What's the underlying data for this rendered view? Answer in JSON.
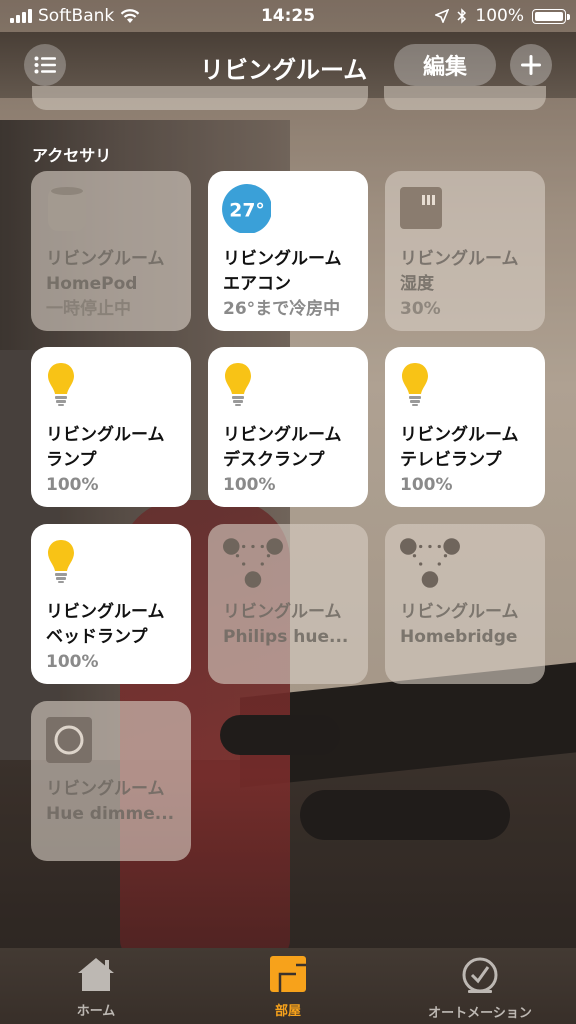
{
  "status": {
    "carrier": "SoftBank",
    "time": "14:25",
    "battery": "100%",
    "battery_level": 1.0
  },
  "nav": {
    "title": "リビングルーム",
    "edit_label": "編集"
  },
  "section": {
    "label": "アクセサリ"
  },
  "tiles": [
    {
      "room": "リビングルーム",
      "name": "HomePod",
      "status": "一時停止中",
      "state": "off",
      "icon": "homepod-icon"
    },
    {
      "room": "リビングルーム",
      "name": "エアコン",
      "status": "26°まで冷房中",
      "state": "on",
      "icon": "thermostat-icon",
      "badge": "27°"
    },
    {
      "room": "リビングルーム",
      "name": "湿度",
      "status": "30%",
      "state": "off",
      "icon": "humidity-sensor-icon"
    },
    {
      "room": "リビングルーム",
      "name": "ランプ",
      "status": "100%",
      "state": "on",
      "icon": "lightbulb-icon"
    },
    {
      "room": "リビングルーム",
      "name": "デスクランプ",
      "status": "100%",
      "state": "on",
      "icon": "lightbulb-icon"
    },
    {
      "room": "リビングルーム",
      "name": "テレビランプ",
      "status": "100%",
      "state": "on",
      "icon": "lightbulb-icon"
    },
    {
      "room": "リビングルーム",
      "name": "ベッドランプ",
      "status": "100%",
      "state": "on",
      "icon": "lightbulb-icon"
    },
    {
      "room": "リビングルーム",
      "name": "Philips hue...",
      "status": "",
      "state": "off",
      "icon": "bridge-icon"
    },
    {
      "room": "リビングルーム",
      "name": "Homebridge",
      "status": "",
      "state": "off",
      "icon": "bridge-icon"
    },
    {
      "room": "リビングルーム",
      "name": "Hue dimme...",
      "status": "",
      "state": "off",
      "icon": "switch-icon"
    }
  ],
  "tabs": [
    {
      "label": "ホーム",
      "icon": "house-icon",
      "active": false
    },
    {
      "label": "部屋",
      "icon": "rooms-icon",
      "active": true
    },
    {
      "label": "オートメーション",
      "icon": "clock-icon",
      "active": false
    }
  ],
  "colors": {
    "accent": "#f7a21b",
    "bulb": "#f8c316",
    "thermostat": "#3aa0d8",
    "tab_inactive": "#bdb8b3"
  }
}
